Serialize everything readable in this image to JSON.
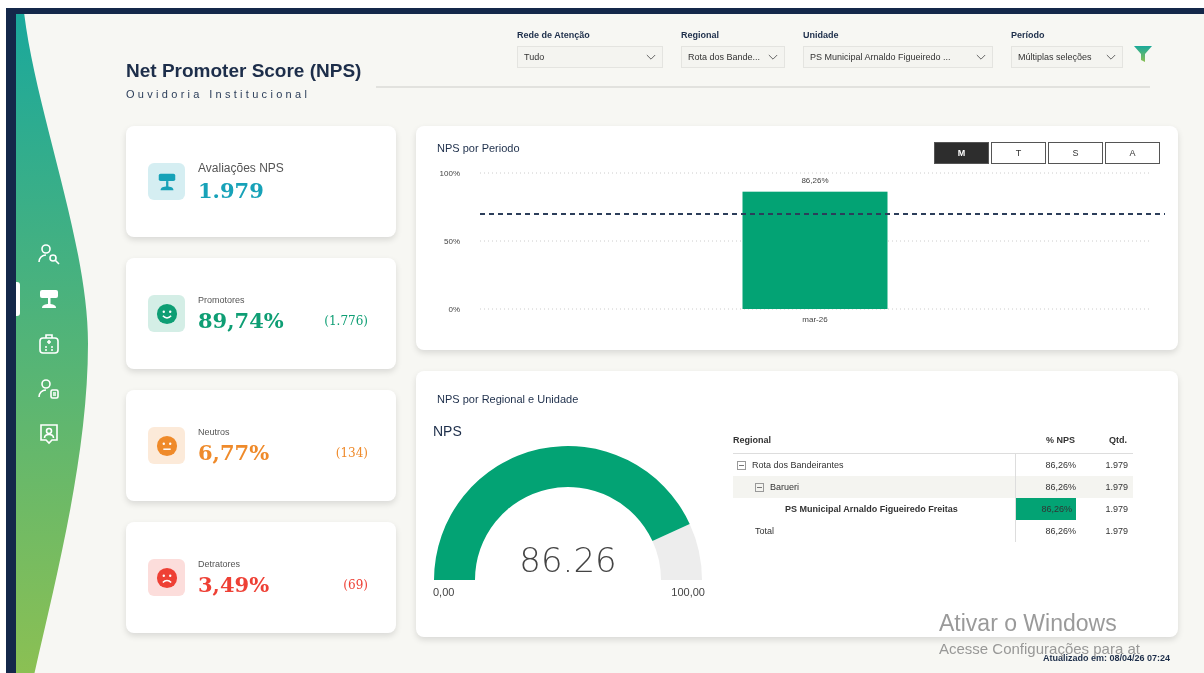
{
  "header": {
    "title": "Net Promoter Score (NPS)",
    "subtitle": "Ouvidoria Institucional"
  },
  "sidebar": {
    "items": [
      {
        "kind": "person-search",
        "selected": false
      },
      {
        "kind": "rating",
        "selected": true
      },
      {
        "kind": "hospital",
        "selected": false
      },
      {
        "kind": "person-card",
        "selected": false
      },
      {
        "kind": "badge",
        "selected": false
      }
    ]
  },
  "filters": [
    {
      "label": "Rede de Atenção",
      "value": "Tudo"
    },
    {
      "label": "Regional",
      "value": "Rota dos Bande..."
    },
    {
      "label": "Unidade",
      "value": "PS Municipal Arnaldo Figueiredo ..."
    },
    {
      "label": "Período",
      "value": "Múltiplas seleções"
    }
  ],
  "kpis": [
    {
      "kind": "rating",
      "label": "Avaliações NPS",
      "value": "1.979",
      "color": "#17a2b8"
    },
    {
      "kind": "happy",
      "label": "Promotores",
      "value": "89,74%",
      "count": "(1.776)",
      "color": "#0e9e74"
    },
    {
      "kind": "neutral",
      "label": "Neutros",
      "value": "6,77%",
      "count": "(134)",
      "color": "#ef8a2a"
    },
    {
      "kind": "sad",
      "label": "Detratores",
      "value": "3,49%",
      "count": "(69)",
      "color": "#ee4035"
    }
  ],
  "period_card": {
    "title": "NPS por Periodo",
    "toggles": [
      {
        "label": "M",
        "selected": true
      },
      {
        "label": "T",
        "selected": false
      },
      {
        "label": "S",
        "selected": false
      },
      {
        "label": "A",
        "selected": false
      }
    ],
    "chart_data": {
      "type": "bar",
      "categories": [
        "mar-26"
      ],
      "values": [
        86.26
      ],
      "ylim": [
        0,
        100
      ],
      "yticks": [
        {
          "value": 0,
          "label": "0%"
        },
        {
          "value": 50,
          "label": "50%"
        },
        {
          "value": 100,
          "label": "100%"
        }
      ],
      "value_labels": [
        "86,26%"
      ]
    }
  },
  "regional_card": {
    "title": "NPS por Regional e Unidade",
    "gauge": {
      "title": "NPS",
      "value": "86.26",
      "min": "0,00",
      "max": "100,00"
    },
    "table": {
      "columns": [
        "Regional",
        "% NPS",
        "Qtd."
      ],
      "rows": [
        {
          "name": "Rota dos Bandeirantes",
          "nps": "86,26%",
          "qtd": "1.979",
          "expanded": true,
          "children": [
            {
              "name": "Barueri",
              "nps": "86,26%",
              "qtd": "1.979",
              "expanded": true,
              "children": [
                {
                  "name": "PS Municipal Arnaldo Figueiredo Freitas",
                  "nps": "86,26%",
                  "qtd": "1.979",
                  "highlighted": true
                }
              ]
            }
          ]
        }
      ],
      "total": {
        "name": "Total",
        "nps": "86,26%",
        "qtd": "1.979"
      }
    }
  },
  "updated": "Atualizado em: 08/04/26 07:24",
  "os_notice": {
    "title": "Ativar o Windows",
    "text": "Acesse Configurações para at"
  }
}
